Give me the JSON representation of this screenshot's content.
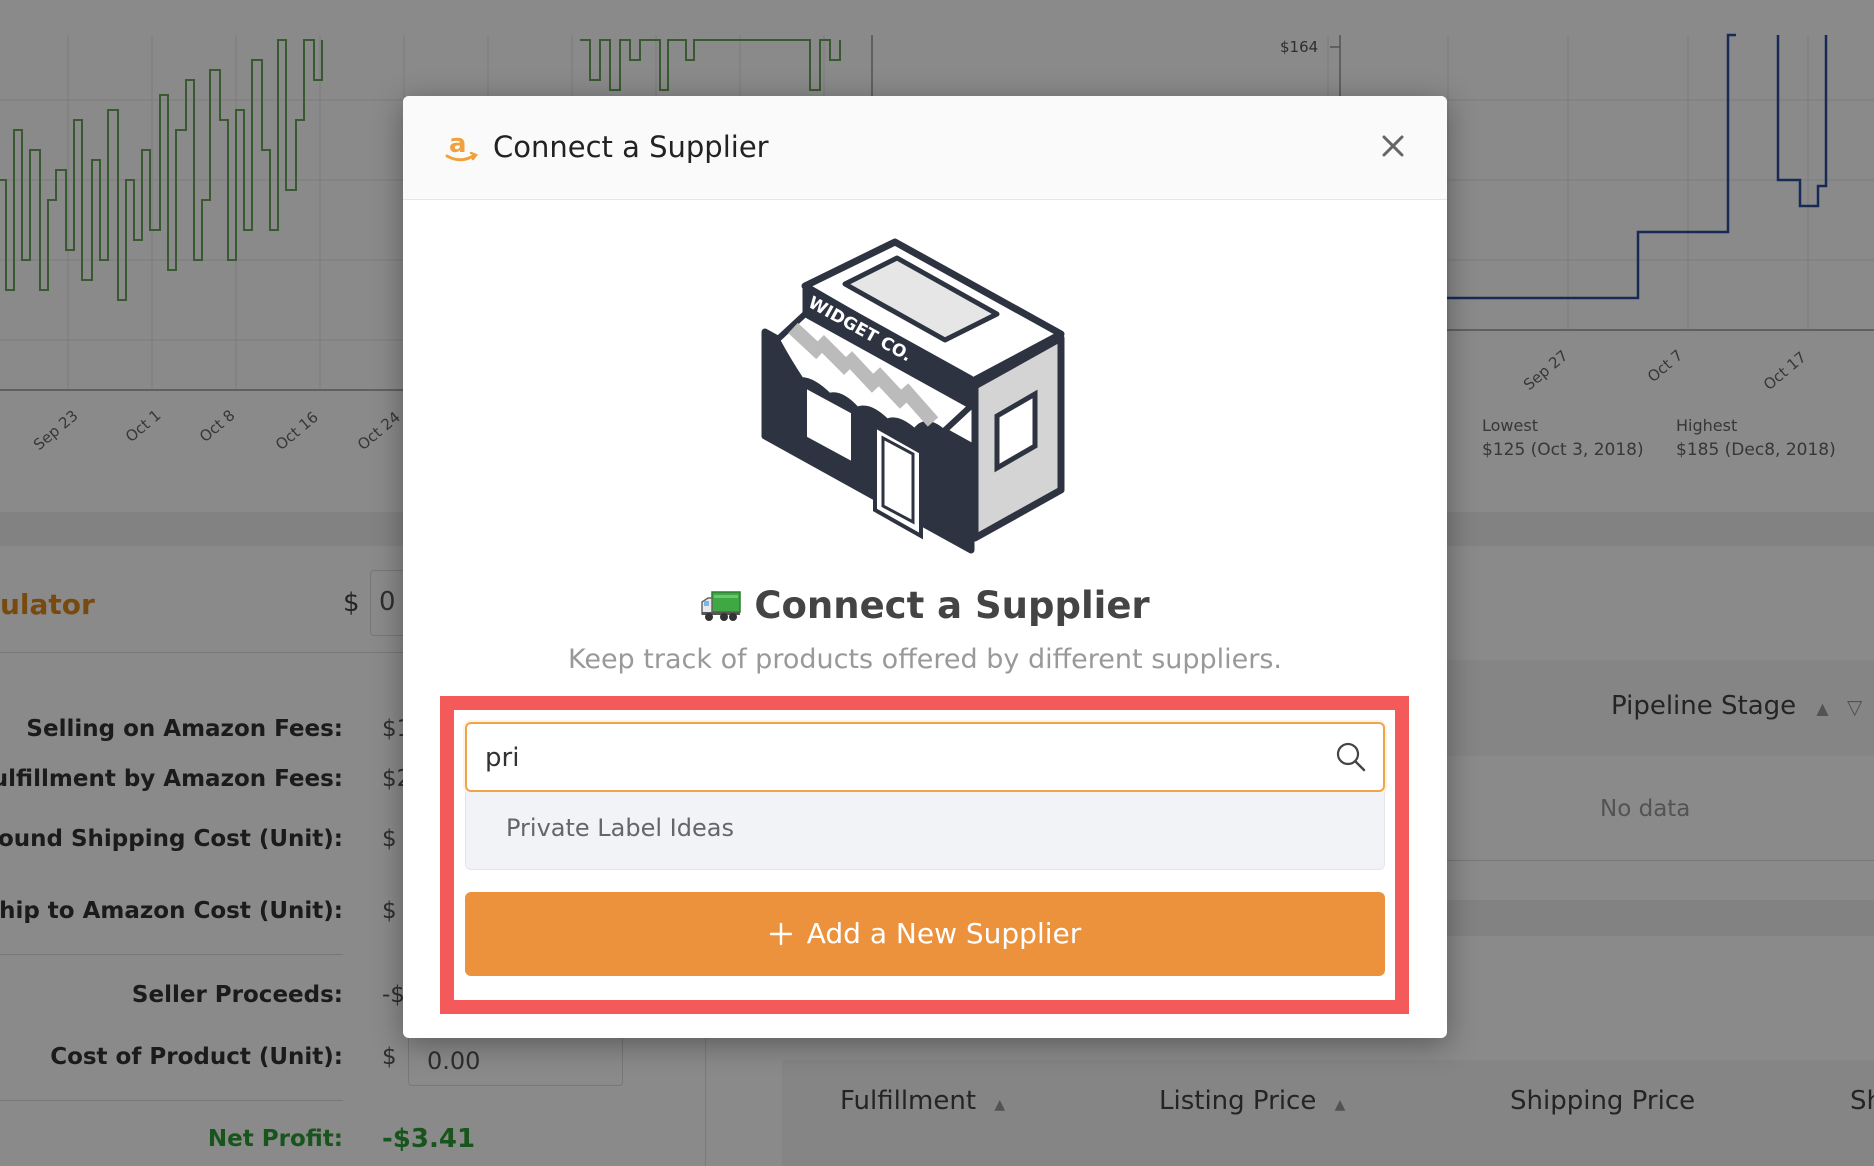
{
  "background": {
    "left_chart": {
      "x_ticks": [
        "Sep 23",
        "Oct 1",
        "Oct 8",
        "Oct 16",
        "Oct 24"
      ]
    },
    "right_chart": {
      "y_tick": "$164",
      "x_ticks": [
        "Sep 27",
        "Oct 7",
        "Oct 17"
      ],
      "lowest_label": "Lowest",
      "lowest_value": "$125 (Oct 3, 2018)",
      "highest_label": "Highest",
      "highest_value": "$185 (Dec8, 2018)"
    },
    "calculator": {
      "title": "ulator",
      "currency": "$",
      "amount_value": "0",
      "rows": [
        {
          "label": "Selling on Amazon Fees:",
          "value": "$1"
        },
        {
          "label": "Fulfillment by Amazon Fees:",
          "value": "$2"
        },
        {
          "label": "bound Shipping Cost (Unit):",
          "value": "$"
        },
        {
          "label": "Ship to Amazon Cost (Unit):",
          "value": "$"
        },
        {
          "label": "Seller Proceeds:",
          "value": "-$"
        },
        {
          "label": "Cost of Product (Unit):",
          "value": "$"
        }
      ],
      "cost_input_value": "0.00",
      "net_profit_label": "Net Profit:",
      "net_profit_value": "-$3.41"
    },
    "pipeline_table": {
      "header": "Pipeline Stage",
      "empty_text": "No data"
    },
    "offers_table": {
      "headers": [
        "Fulfillment",
        "Listing Price",
        "Shipping Price",
        "Sh"
      ]
    }
  },
  "modal": {
    "title": "Connect a Supplier",
    "store_sign": "WIDGET CO.",
    "hero_title": "Connect a Supplier",
    "hero_subtitle": "Keep track of products offered by different suppliers.",
    "search": {
      "value": "pri"
    },
    "dropdown_options": [
      "Private Label Ideas"
    ],
    "add_button_label": "Add a New Supplier"
  },
  "colors": {
    "accent": "#ec923c",
    "highlight": "#f55a5a",
    "amazon_orange": "#f0a03c"
  }
}
